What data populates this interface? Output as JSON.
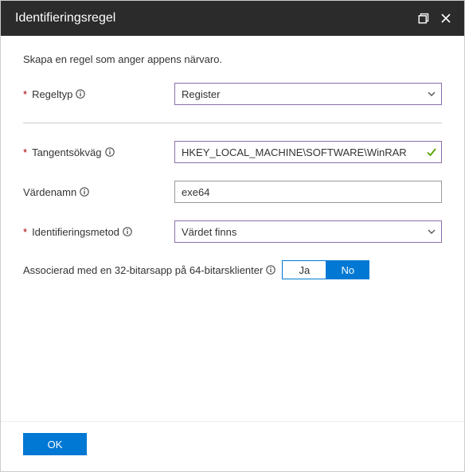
{
  "header": {
    "title": "Identifieringsregel"
  },
  "form": {
    "description": "Skapa en regel som anger appens närvaro.",
    "fields": {
      "rule_type": {
        "label": "Regeltyp",
        "value": "Register"
      },
      "key_path": {
        "label": "Tangentsökväg",
        "value": "HKEY_LOCAL_MACHINE\\SOFTWARE\\WinRAR"
      },
      "value_name": {
        "label": "Värdenamn",
        "value": "exe64"
      },
      "detection_method": {
        "label": "Identifieringsmetod",
        "value": "Värdet finns"
      },
      "associated_32bit": {
        "label": "Associerad med en 32-bitarsapp på 64-bitarsklienter",
        "option_yes": "Ja",
        "option_no": "No"
      }
    }
  },
  "footer": {
    "ok_label": "OK"
  }
}
